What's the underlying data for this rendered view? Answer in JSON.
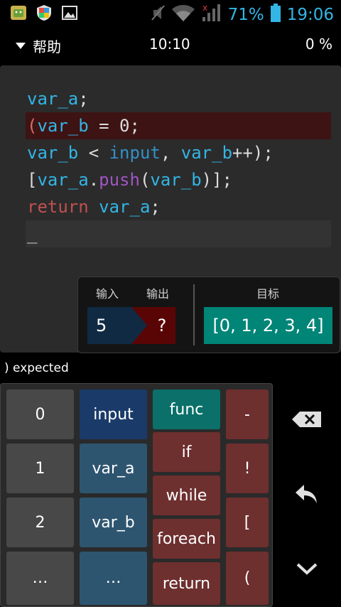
{
  "status_bar": {
    "battery_pct": "71%",
    "time": "19:06",
    "icons": [
      "android-app-icon",
      "shield-icon",
      "image-icon",
      "mute-icon",
      "wifi-icon",
      "signal-icon",
      "battery-icon"
    ]
  },
  "header": {
    "help_label": "帮助",
    "clock": "10:10",
    "progress": "0 %"
  },
  "code": {
    "lines": [
      [
        {
          "t": "var_a",
          "c": "c-var"
        },
        {
          "t": ";",
          "c": "c-p"
        }
      ],
      [
        {
          "t": "(",
          "c": "c-errp"
        },
        {
          "t": "var_b",
          "c": "c-var"
        },
        {
          "t": " = 0;",
          "c": "c-p"
        }
      ],
      [
        {
          "t": "var_b",
          "c": "c-var"
        },
        {
          "t": " < ",
          "c": "c-p"
        },
        {
          "t": "input",
          "c": "c-kw"
        },
        {
          "t": ", ",
          "c": "c-p"
        },
        {
          "t": "var_b",
          "c": "c-var"
        },
        {
          "t": "++);",
          "c": "c-p"
        }
      ],
      [
        {
          "t": "[",
          "c": "c-p"
        },
        {
          "t": "var_a",
          "c": "c-var"
        },
        {
          "t": ".",
          "c": "c-p"
        },
        {
          "t": "push",
          "c": "c-m"
        },
        {
          "t": "(",
          "c": "c-p"
        },
        {
          "t": "var_b",
          "c": "c-var"
        },
        {
          "t": ")];",
          "c": "c-p"
        }
      ],
      [
        {
          "t": "return",
          "c": "c-ret"
        },
        {
          "t": " ",
          "c": "c-p"
        },
        {
          "t": "var_a",
          "c": "c-var"
        },
        {
          "t": ";",
          "c": "c-p"
        }
      ],
      [
        {
          "t": "_",
          "c": "c-p"
        }
      ]
    ]
  },
  "io": {
    "input_label": "输入",
    "output_label": "输出",
    "target_label": "目标",
    "input_value": "5",
    "output_value": "?",
    "target_value": "[0, 1, 2, 3, 4]"
  },
  "message": ") expected",
  "keypad": {
    "col_numbers": [
      "0",
      "1",
      "2",
      "…"
    ],
    "col_vars": [
      "input",
      "var_a",
      "var_b",
      "…"
    ],
    "col_keywords": [
      "func",
      "if",
      "while",
      "foreach",
      "return"
    ],
    "col_symbols": [
      "-",
      "!",
      "[",
      "("
    ]
  },
  "colors": {
    "accent": "#33b5e5",
    "target": "#008577",
    "error_line": "#3d1313",
    "keyword_key": "#6e2f2f"
  }
}
